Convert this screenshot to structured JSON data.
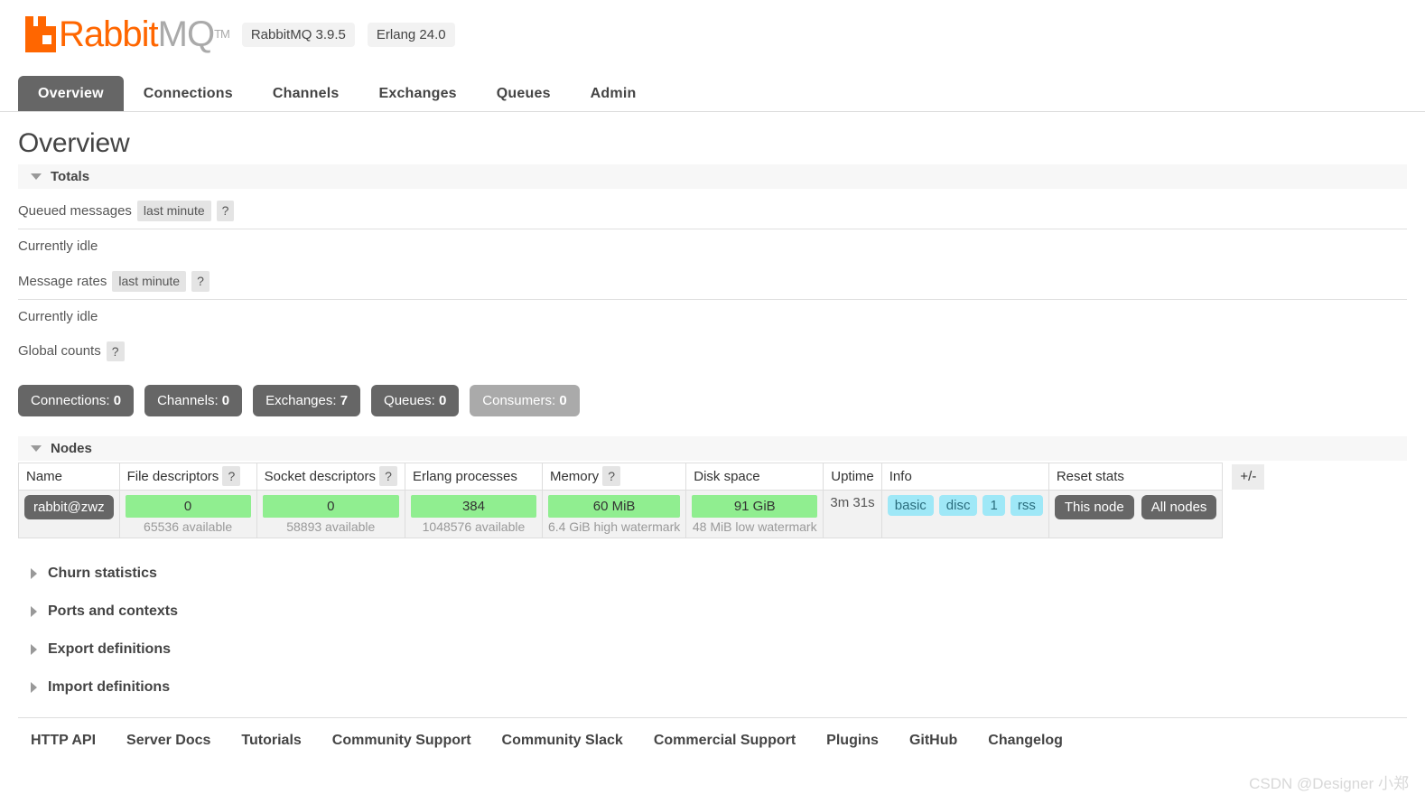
{
  "brand": {
    "name_primary": "Rabbit",
    "name_secondary": "MQ",
    "trademark": "TM",
    "version_pill": "RabbitMQ 3.9.5",
    "erlang_pill": "Erlang 24.0"
  },
  "nav": {
    "tabs": [
      {
        "label": "Overview",
        "active": true
      },
      {
        "label": "Connections",
        "active": false
      },
      {
        "label": "Channels",
        "active": false
      },
      {
        "label": "Exchanges",
        "active": false
      },
      {
        "label": "Queues",
        "active": false
      },
      {
        "label": "Admin",
        "active": false
      }
    ]
  },
  "page": {
    "title": "Overview"
  },
  "totals": {
    "section_label": "Totals",
    "queued_messages_label": "Queued messages",
    "queued_messages_period": "last minute",
    "queued_messages_help": "?",
    "queued_messages_status": "Currently idle",
    "message_rates_label": "Message rates",
    "message_rates_period": "last minute",
    "message_rates_help": "?",
    "message_rates_status": "Currently idle",
    "global_counts_label": "Global counts",
    "global_counts_help": "?",
    "counts": [
      {
        "label": "Connections:",
        "value": "0",
        "muted": false
      },
      {
        "label": "Channels:",
        "value": "0",
        "muted": false
      },
      {
        "label": "Exchanges:",
        "value": "7",
        "muted": false
      },
      {
        "label": "Queues:",
        "value": "0",
        "muted": false
      },
      {
        "label": "Consumers:",
        "value": "0",
        "muted": true
      }
    ]
  },
  "nodes": {
    "section_label": "Nodes",
    "columns": {
      "name": "Name",
      "file_descriptors": "File descriptors",
      "file_descriptors_help": "?",
      "socket_descriptors": "Socket descriptors",
      "socket_descriptors_help": "?",
      "erlang_processes": "Erlang processes",
      "memory": "Memory",
      "memory_help": "?",
      "disk_space": "Disk space",
      "uptime": "Uptime",
      "info": "Info",
      "reset_stats": "Reset stats"
    },
    "row": {
      "name": "rabbit@zwz",
      "file_descriptors_value": "0",
      "file_descriptors_sub": "65536 available",
      "socket_descriptors_value": "0",
      "socket_descriptors_sub": "58893 available",
      "erlang_processes_value": "384",
      "erlang_processes_sub": "1048576 available",
      "memory_value": "60 MiB",
      "memory_sub": "6.4 GiB high watermark",
      "disk_space_value": "91 GiB",
      "disk_space_sub": "48 MiB low watermark",
      "uptime_value": "3m 31s",
      "info_badges": [
        "basic",
        "disc",
        "1",
        "rss"
      ],
      "reset_this_node": "This node",
      "reset_all_nodes": "All nodes"
    },
    "column_toggle": "+/-"
  },
  "collapsed_sections": [
    {
      "label": "Churn statistics"
    },
    {
      "label": "Ports and contexts"
    },
    {
      "label": "Export definitions"
    },
    {
      "label": "Import definitions"
    }
  ],
  "footer": {
    "links": [
      "HTTP API",
      "Server Docs",
      "Tutorials",
      "Community Support",
      "Community Slack",
      "Commercial Support",
      "Plugins",
      "GitHub",
      "Changelog"
    ]
  },
  "watermark": "CSDN @Designer 小郑",
  "colors": {
    "brand_orange": "#f60",
    "accent_gray": "#666",
    "bar_green": "#90ee90",
    "info_badge_blue": "#9fe8f7"
  }
}
